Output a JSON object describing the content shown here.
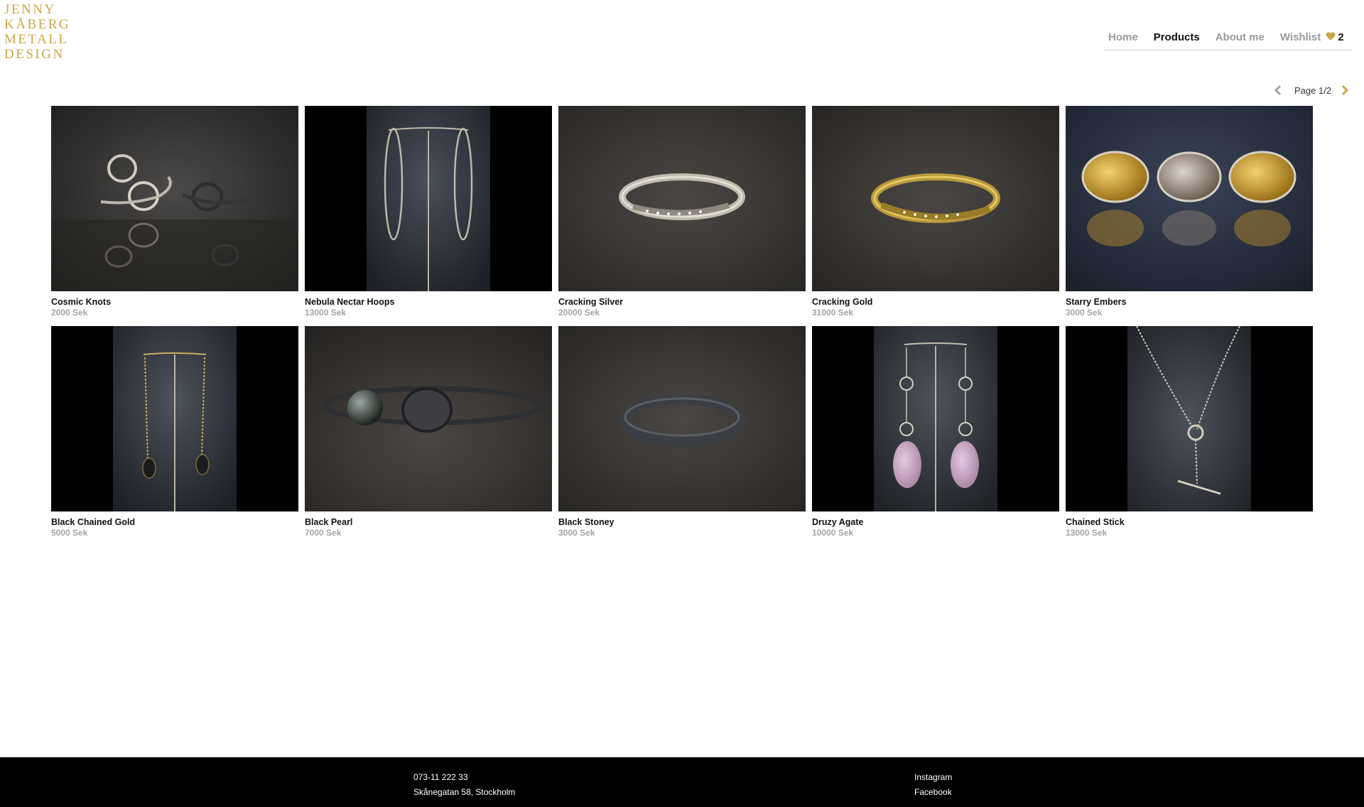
{
  "brand": {
    "logo_lines": [
      "JENNY",
      "KÅBERG",
      "METALL",
      "DESIGN"
    ],
    "accent_color": "#c9a64a"
  },
  "nav": {
    "items": [
      {
        "label": "Home",
        "active": false
      },
      {
        "label": "Products",
        "active": true
      },
      {
        "label": "About me",
        "active": false
      }
    ],
    "wishlist_label": "Wishlist",
    "wishlist_icon": "heart-icon",
    "wishlist_count": "2"
  },
  "pager": {
    "label": "Page 1/2",
    "prev_icon": "chevron-left-icon",
    "next_icon": "chevron-right-icon"
  },
  "products": [
    {
      "name": "Cosmic Knots",
      "price": "2000 Sek"
    },
    {
      "name": "Nebula Nectar Hoops",
      "price": "13000 Sek"
    },
    {
      "name": "Cracking Silver",
      "price": "20000 Sek"
    },
    {
      "name": "Cracking Gold",
      "price": "31000 Sek"
    },
    {
      "name": "Starry Embers",
      "price": "3000 Sek"
    },
    {
      "name": "Black Chained Gold",
      "price": "5000 Sek"
    },
    {
      "name": "Black Pearl",
      "price": "7000 Sek"
    },
    {
      "name": "Black Stoney",
      "price": "3000 Sek"
    },
    {
      "name": "Druzy Agate",
      "price": "10000 Sek"
    },
    {
      "name": "Chained Stick",
      "price": "13000 Sek"
    }
  ],
  "footer": {
    "phone": "073-11 222 33",
    "address": "Skånegatan 58, Stockholm",
    "links": [
      "Instagram",
      "Facebook"
    ]
  }
}
